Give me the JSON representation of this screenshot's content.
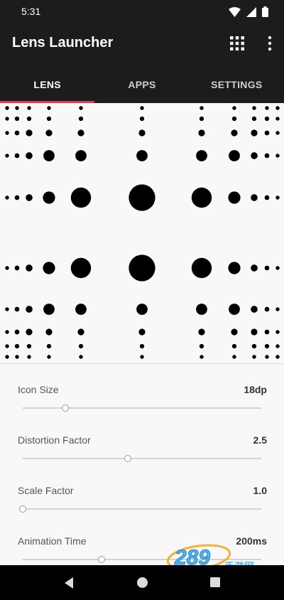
{
  "status_bar": {
    "time": "5:31",
    "icons": [
      "wifi-icon",
      "signal-icon",
      "battery-icon"
    ]
  },
  "app_bar": {
    "title": "Lens Launcher",
    "actions": [
      "apps-grid-icon",
      "more-vert-icon"
    ]
  },
  "tabs": [
    {
      "label": "LENS",
      "active": true
    },
    {
      "label": "APPS",
      "active": false
    },
    {
      "label": "SETTINGS",
      "active": false
    }
  ],
  "colors": {
    "app_bar": "#1c1c1c",
    "tab_indicator": "#e33a5c",
    "background": "#f8f8f8"
  },
  "settings": [
    {
      "label": "Icon Size",
      "value": "18dp",
      "slider": 0.18
    },
    {
      "label": "Distortion Factor",
      "value": "2.5",
      "slider": 0.44
    },
    {
      "label": "Scale Factor",
      "value": "1.0",
      "slider": 0.0
    },
    {
      "label": "Animation Time",
      "value": "200ms",
      "slider": 0.33
    }
  ],
  "watermark": {
    "number": "289",
    "text": "手游网"
  },
  "nav_bar": [
    "back-icon",
    "home-icon",
    "recents-icon"
  ]
}
